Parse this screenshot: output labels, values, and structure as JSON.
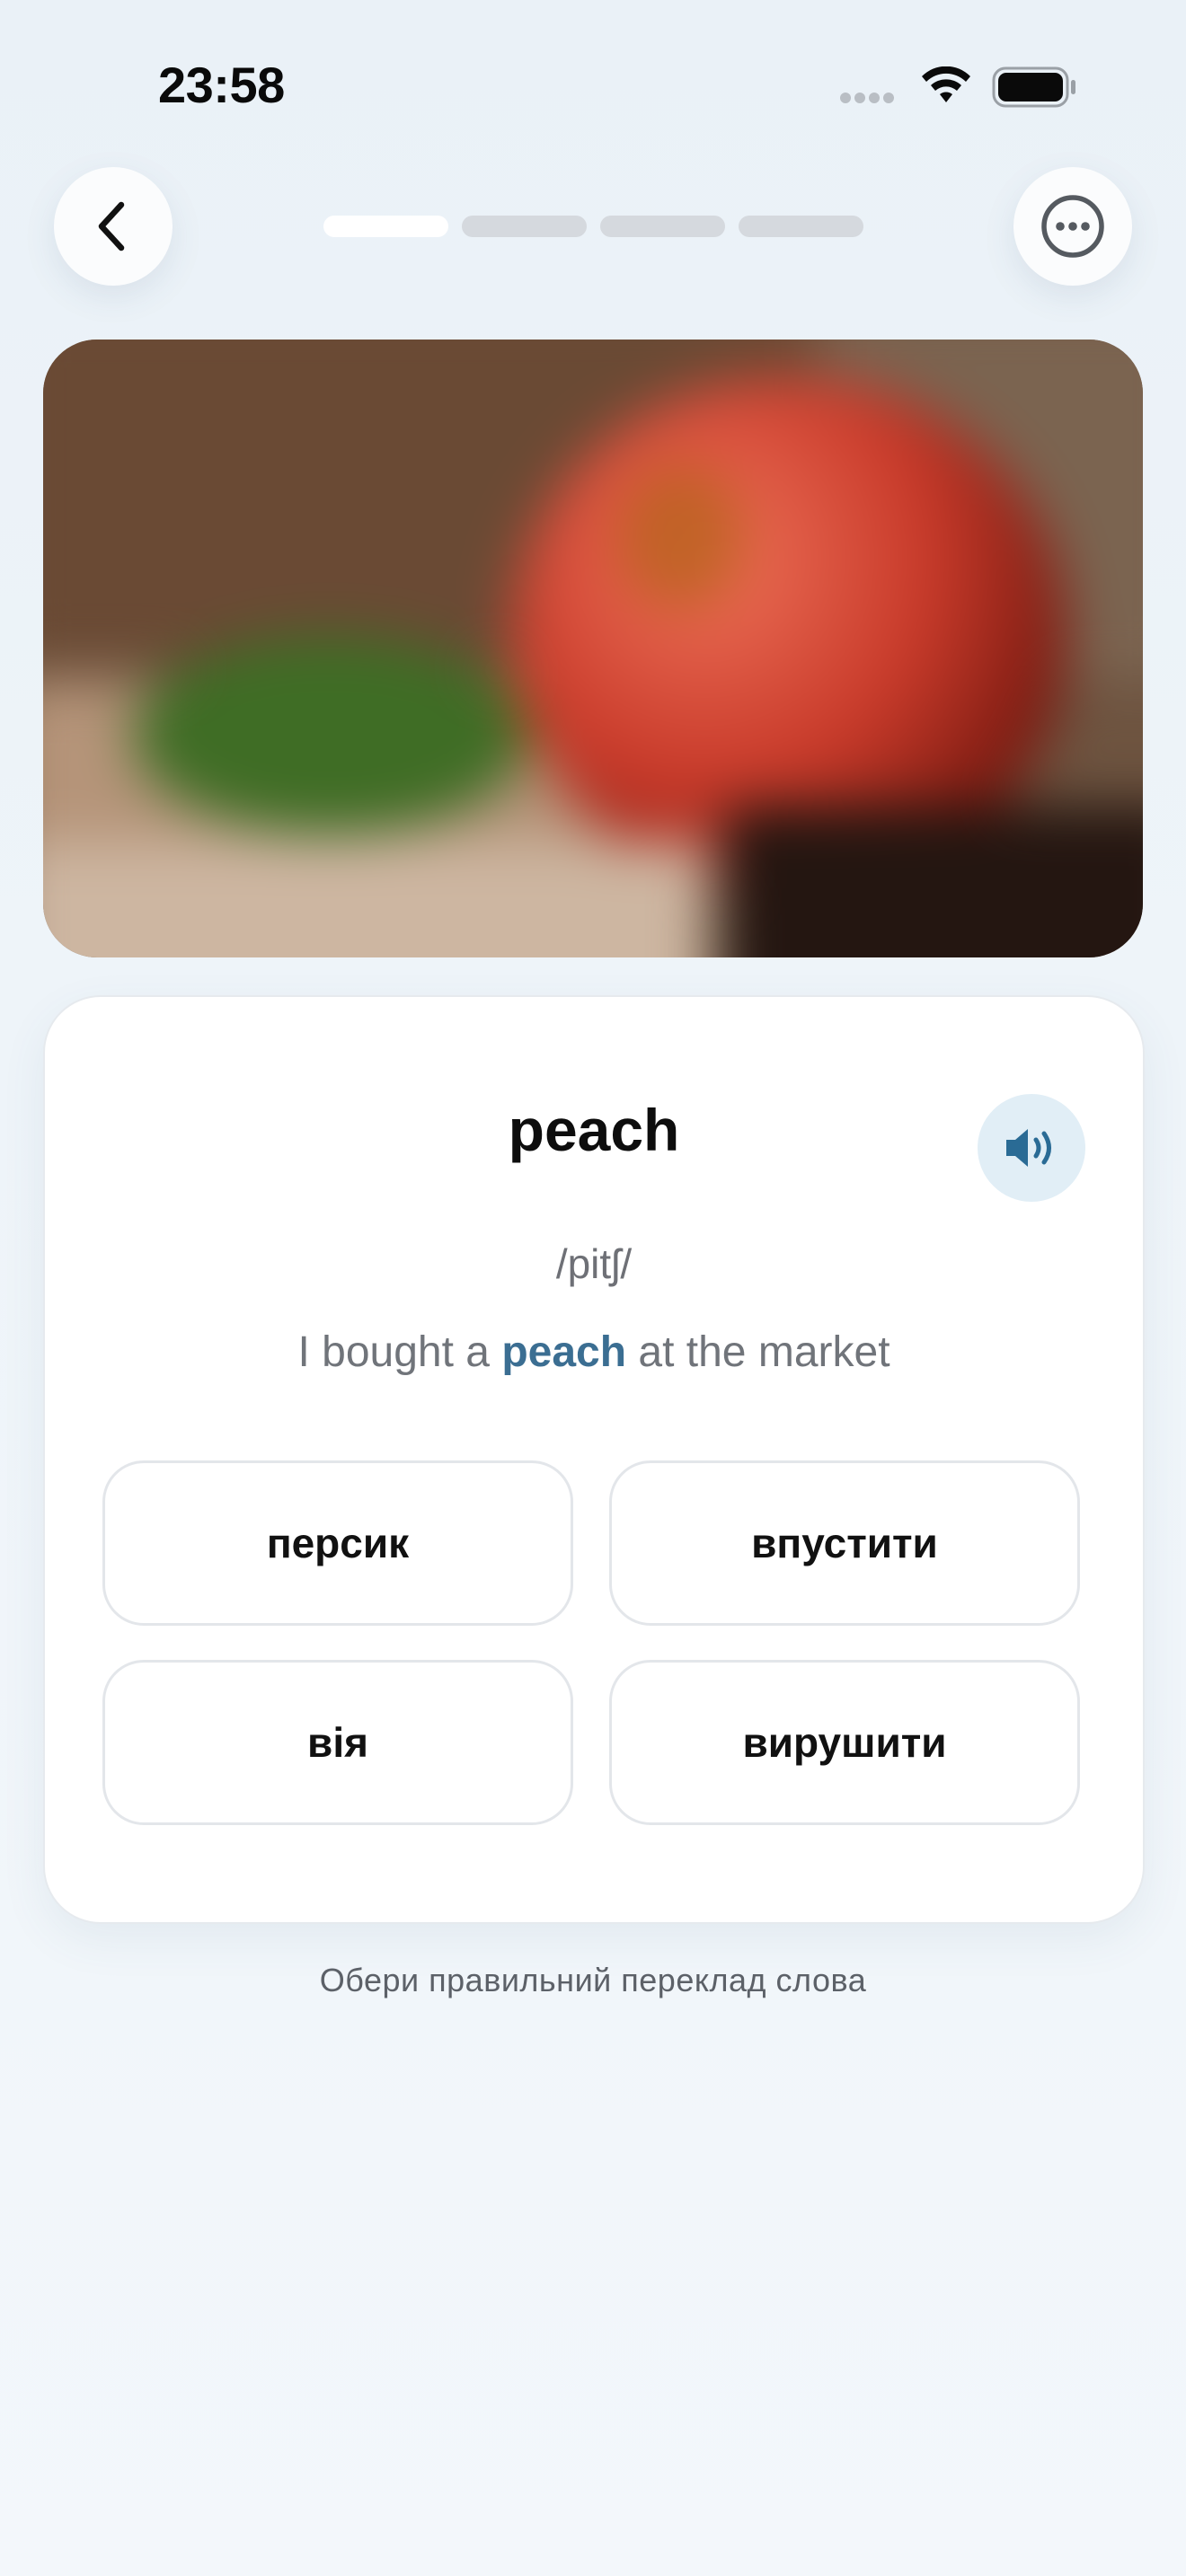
{
  "status_bar": {
    "time": "23:58",
    "signal_icon": "cellular-signal-icon",
    "wifi_icon": "wifi-icon",
    "battery_icon": "battery-icon"
  },
  "nav": {
    "back_icon": "chevron-left-icon",
    "more_icon": "ellipsis-circle-icon",
    "progress_total_steps": 4,
    "progress_current_step": 1
  },
  "image": {
    "icon": "blurred-photo"
  },
  "card": {
    "word": "peach",
    "phonetic": "/pitʃ/",
    "speaker_icon": "speaker-icon",
    "example": {
      "before": "I bought a",
      "highlight": "peach",
      "after": "at the market"
    },
    "options": [
      "персик",
      "впустити",
      "вія",
      "вирушити"
    ]
  },
  "hint": "Обери правильний переклад слова",
  "colors": {
    "accent": "#3b6e92",
    "speaker_bg": "#e1eef6",
    "background": "#eef4f9"
  }
}
